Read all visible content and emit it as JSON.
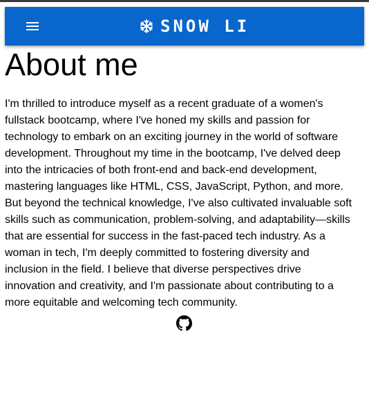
{
  "header": {
    "title": "SNOW LI",
    "menu_icon": "hamburger-menu-icon",
    "logo_icon": "snowflake-icon",
    "background_color": "#0866cc"
  },
  "main": {
    "title": "About me",
    "paragraph": "I'm thrilled to introduce myself as a recent graduate of a women's fullstack bootcamp, where I've honed my skills and passion for technology to embark on an exciting journey in the world of software development. Throughout my time in the bootcamp, I've delved deep into the intricacies of both front-end and back-end development, mastering languages like HTML, CSS, JavaScript, Python, and more. But beyond the technical knowledge, I've also cultivated invaluable soft skills such as communication, problem-solving, and adaptability—skills that are essential for success in the fast-paced tech industry. As a woman in tech, I'm deeply committed to fostering diversity and inclusion in the field. I believe that diverse perspectives drive innovation and creativity, and I'm passionate about contributing to a more equitable and welcoming tech community.",
    "social_icon": "github-icon"
  }
}
